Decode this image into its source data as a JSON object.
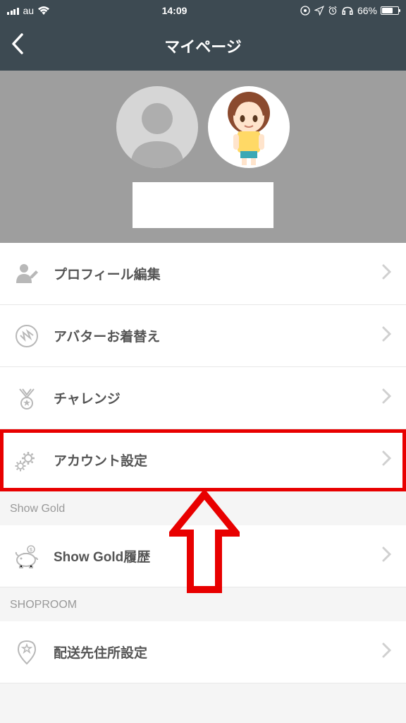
{
  "status_bar": {
    "carrier": "au",
    "time": "14:09",
    "battery_pct": "66%"
  },
  "nav": {
    "title": "マイページ"
  },
  "menu": {
    "profile_edit": "プロフィール編集",
    "avatar_change": "アバターお着替え",
    "challenge": "チャレンジ",
    "account_settings": "アカウント設定",
    "show_gold_history": "Show Gold履歴",
    "address_settings": "配送先住所設定"
  },
  "sections": {
    "show_gold": "Show Gold",
    "shoproom": "SHOPROOM"
  }
}
